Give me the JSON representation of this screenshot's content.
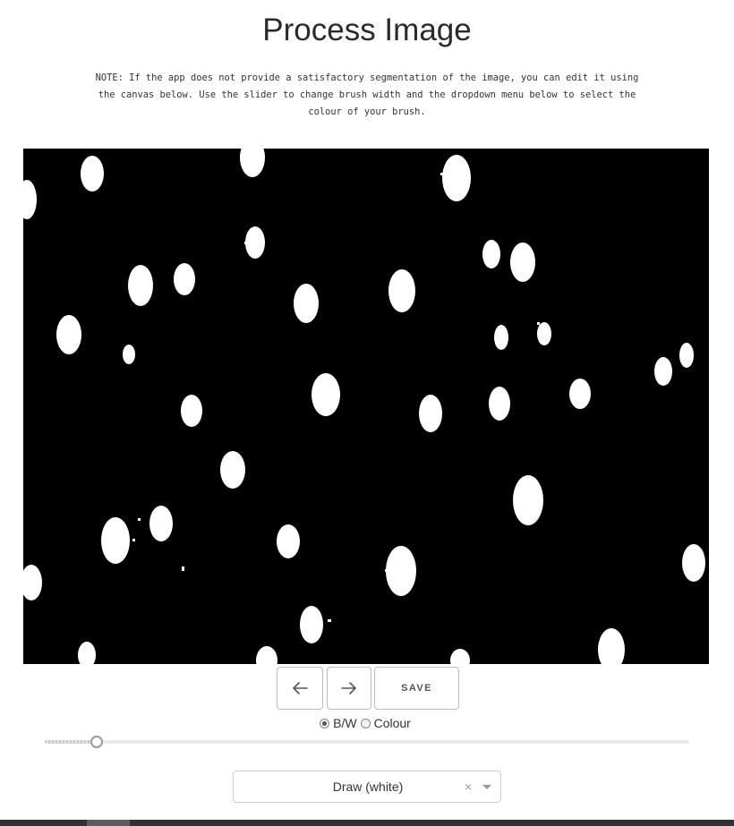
{
  "header": {
    "title": "Process Image"
  },
  "note": {
    "text": "NOTE: If the app does not provide a satisfactory segmentation of the image, you can edit it using the canvas below. Use the slider to change brush width and the dropdown menu below to select the colour of your brush."
  },
  "canvas": {
    "background": "#000000",
    "foreground": "#ffffff",
    "content": "binary-segmentation-mask"
  },
  "toolbar": {
    "prev_icon": "arrow-left-icon",
    "next_icon": "arrow-right-icon",
    "save_label": "SAVE"
  },
  "mode": {
    "options": [
      {
        "label": "B/W",
        "checked": true
      },
      {
        "label": "Colour",
        "checked": false
      }
    ]
  },
  "brush": {
    "width_fraction": 0.08
  },
  "colour_select": {
    "value": "Draw (white)",
    "clear_icon": "clear-x-icon",
    "arrow_icon": "chevron-down-icon"
  }
}
